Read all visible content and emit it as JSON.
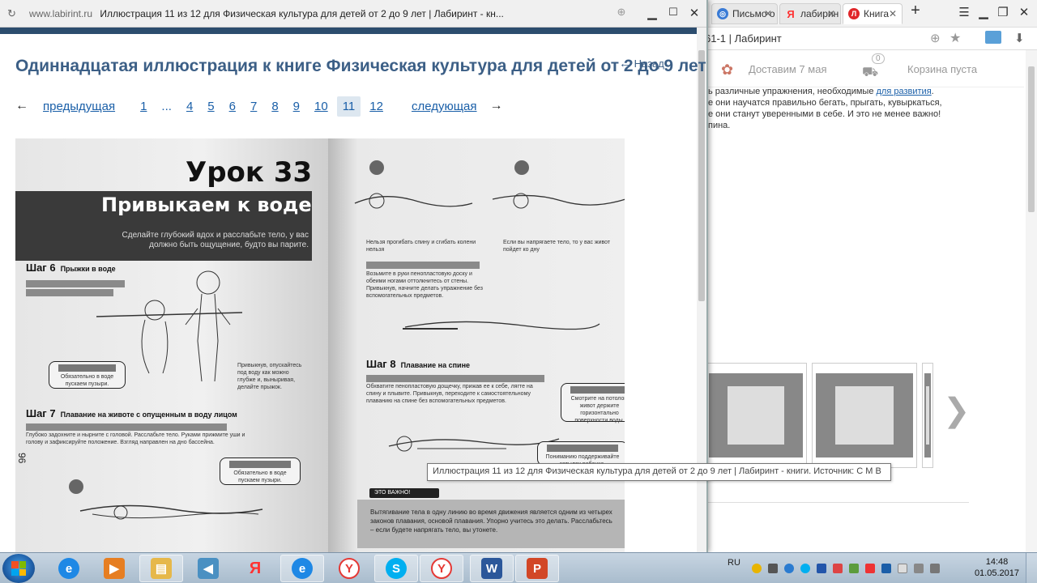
{
  "background_browser": {
    "tabs": [
      {
        "label": "Письмо о",
        "icon": "mail-icon",
        "color": "#3a7bd5"
      },
      {
        "label": "лабирин",
        "icon": "yandex-icon",
        "color": "#ff3333"
      },
      {
        "label": "Книга",
        "icon": "labirint-icon",
        "color": "#e0262a"
      }
    ],
    "new_tab_label": "+",
    "url": "61-1 | Лабиринт",
    "header": {
      "delivery": "Доставим 7 мая",
      "cart_count": "0",
      "cart": "Корзина пуста"
    },
    "text_lines": [
      "ь различные упражнения, необходимые ",
      "е они научатся правильно бегать, прыгать, кувыркаться,",
      "е они станут уверенными в себе. И это не менее важно!",
      "пина."
    ],
    "text_link": "для развития",
    "text_link_suffix": ".",
    "next_arrow": "❯"
  },
  "popup": {
    "domain": "www.labirint.ru",
    "window_title": "Иллюстрация 11 из 12 для Физическая культура для детей от 2 до 9 лет | Лабиринт - кн...",
    "heading": "Одиннадцатая иллюстрация к книге Физическая культура для детей от 2 до 9 лет",
    "back_label": "Назад",
    "back_arrow": "←",
    "prev_arrow": "←",
    "next_arrow": "→",
    "prev_label": "предыдущая",
    "next_label": "следующая",
    "pages": [
      "1",
      "...",
      "4",
      "5",
      "6",
      "7",
      "8",
      "9",
      "10",
      "11",
      "12"
    ],
    "current_page": "11"
  },
  "illustration": {
    "lesson": "Урок 33",
    "lesson_title": "Привыкаем к воде",
    "lesson_subtitle": "Сделайте глубокий вдох и расслабьте тело, у вас должно быть ощущение, будто вы парите.",
    "step6_title": "Шаг 6",
    "step6_name": "Прыжки в воде",
    "step7_title": "Шаг 7",
    "step7_name": "Плавание на животе с опущенным в воду лицом",
    "step8_title": "Шаг 8",
    "step8_name": "Плавание на спине",
    "left_note1": "Обязательно в воде пускаем пузыри.",
    "left_text1": "Привыкнув, опускайтесь под воду как можно глубже и, выныривая, делайте прыжок.",
    "left_text2": "Глубоко задохните и нырните с головой. Расслабьте тело. Руками прижмите уши и голову и зафиксируйте положение. Взгляд направлен на дно бассейна.",
    "left_note2": "Обязательно в воде пускаем пузыри.",
    "right_text1": "Нельзя прогибать спину и сгибать колени нельзя",
    "right_text2": "Если вы напрягаете тело, то у вас живот пойдет ко дну",
    "right_text3": "Возьмите в руки пенопластовую доску и обеими ногами оттолкнитесь от стены. Привыкнув, начните делать упражнение без вспомогательных предметов.",
    "right_text4": "Обхватите пенопластовую дощечку, прижав ее к себе, лягте на спину и плывите. Привыкнув, переходите к самостоятельному плаванию на спине без вспомогательных предметов.",
    "right_note1": "Смотрите на потолок, живот держите горизонтально поверхности воды.",
    "right_note2": "Пониманию поддерживайте затылок ребенка.",
    "important_label": "ЭТО ВАЖНО!",
    "important_text": "Вытягивание тела в одну линию во время движения является одним из четырех законов плавания, основой плавания. Упорно учитесь это делать. Расслабьтесь – если будете напрягать тело, вы утонете.",
    "page_number": "96"
  },
  "tooltip": "Иллюстрация 11 из 12 для Физическая культура для детей от 2 до 9 лет | Лабиринт - книги. Источник: С М В",
  "taskbar": {
    "apps": [
      {
        "name": "internet-explorer",
        "icon": "e",
        "color": "#1e88e5"
      },
      {
        "name": "media-player",
        "icon": "▶",
        "color": "#e67e22"
      },
      {
        "name": "file-explorer",
        "icon": "▤",
        "color": "#e6b84a"
      },
      {
        "name": "audio",
        "icon": "◀",
        "color": "#4a90c2"
      },
      {
        "name": "yandex",
        "icon": "Я",
        "color": "#ff3333"
      },
      {
        "name": "internet-explorer-2",
        "icon": "e",
        "color": "#1e88e5"
      },
      {
        "name": "yandex-browser",
        "icon": "Y",
        "color": "#e53935"
      },
      {
        "name": "skype",
        "icon": "S",
        "color": "#00aff0"
      },
      {
        "name": "yandex-browser-2",
        "icon": "Y",
        "color": "#e53935"
      },
      {
        "name": "word",
        "icon": "W",
        "color": "#2b579a"
      },
      {
        "name": "powerpoint",
        "icon": "P",
        "color": "#d24726"
      }
    ],
    "language": "RU",
    "time": "14:48",
    "date": "01.05.2017"
  }
}
